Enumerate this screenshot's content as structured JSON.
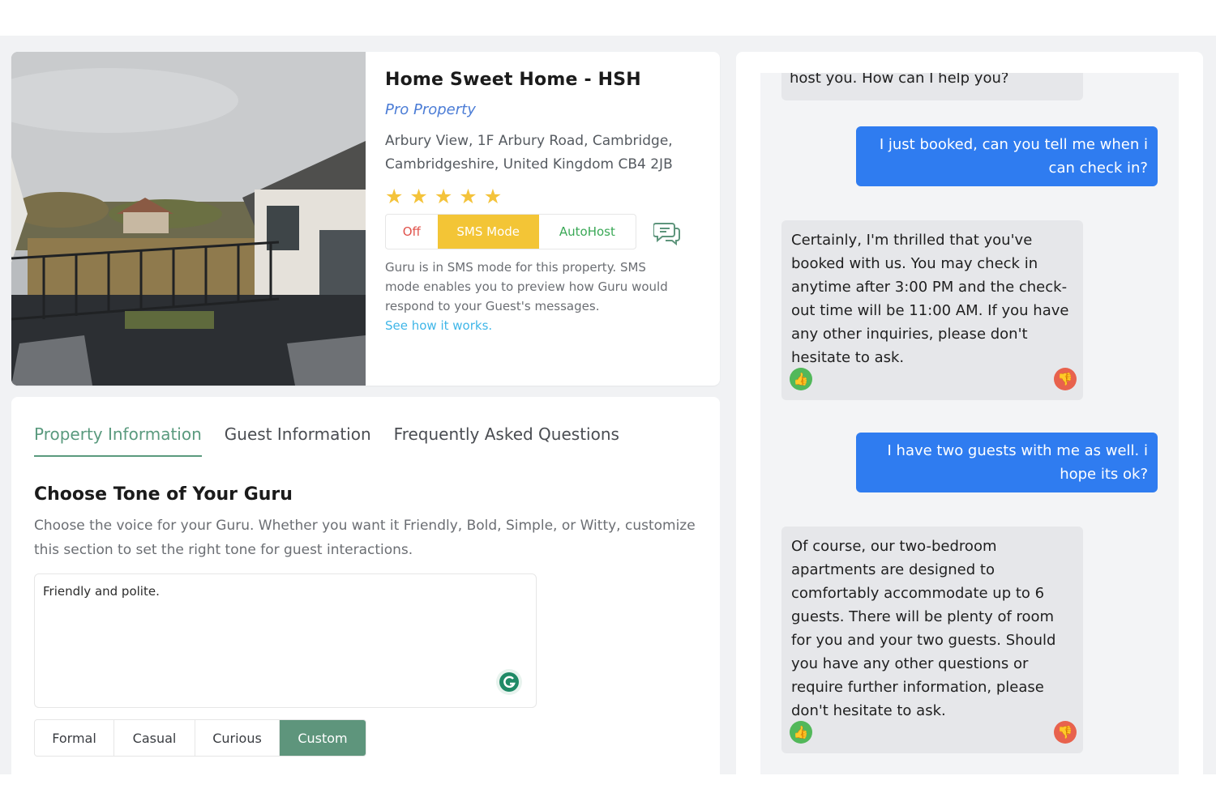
{
  "property": {
    "title": "Home Sweet Home - HSH",
    "badge": "Pro Property",
    "address": "Arbury View, 1F Arbury Road, Cambridge, Cambridgeshire, United Kingdom CB4 2JB",
    "rating": 5,
    "stars": [
      "★",
      "★",
      "★",
      "★",
      "★"
    ]
  },
  "mode": {
    "off_label": "Off",
    "sms_label": "SMS Mode",
    "autohost_label": "AutoHost",
    "selected": "SMS Mode",
    "description": "Guru is in SMS mode for this property. SMS mode enables you to preview how Guru would respond to your Guest's messages.",
    "link": "See how it works."
  },
  "tabs": [
    {
      "label": "Property Information",
      "active": true
    },
    {
      "label": "Guest Information",
      "active": false
    },
    {
      "label": "Frequently Asked Questions",
      "active": false
    }
  ],
  "tone": {
    "title": "Choose Tone of Your Guru",
    "description": "Choose the voice for your Guru. Whether you want it Friendly, Bold, Simple, or Witty, customize this section to set the right tone for guest interactions.",
    "value": "Friendly and polite.",
    "options": [
      "Formal",
      "Casual",
      "Curious",
      "Custom"
    ],
    "selected": "Custom"
  },
  "chat": {
    "messages": [
      {
        "role": "bot",
        "text": "host you. How can I help you?"
      },
      {
        "role": "user",
        "text": "I just booked, can you tell me when i can check in?"
      },
      {
        "role": "bot",
        "text": "Certainly, I'm thrilled that you've booked with us. You may check in anytime after 3:00 PM and the check-out time will be 11:00 AM. If you have any other inquiries, please don't hesitate to ask."
      },
      {
        "role": "user",
        "text": "I have two guests with me as well. i hope its ok?"
      },
      {
        "role": "bot",
        "text": "Of course, our two-bedroom apartments are designed to comfortably accommodate up to 6 guests. There will be plenty of room for you and your two guests. Should you have any other questions or require further information, please don't hesitate to ask."
      }
    ],
    "thumb_up_icon": "👍",
    "thumb_down_icon": "👎"
  },
  "colors": {
    "accent_green": "#5e957c",
    "sms_yellow": "#f3c536",
    "user_bubble": "#2f7cf0",
    "bot_bubble": "#e6e7ea",
    "link_blue": "#3fb6e8"
  }
}
